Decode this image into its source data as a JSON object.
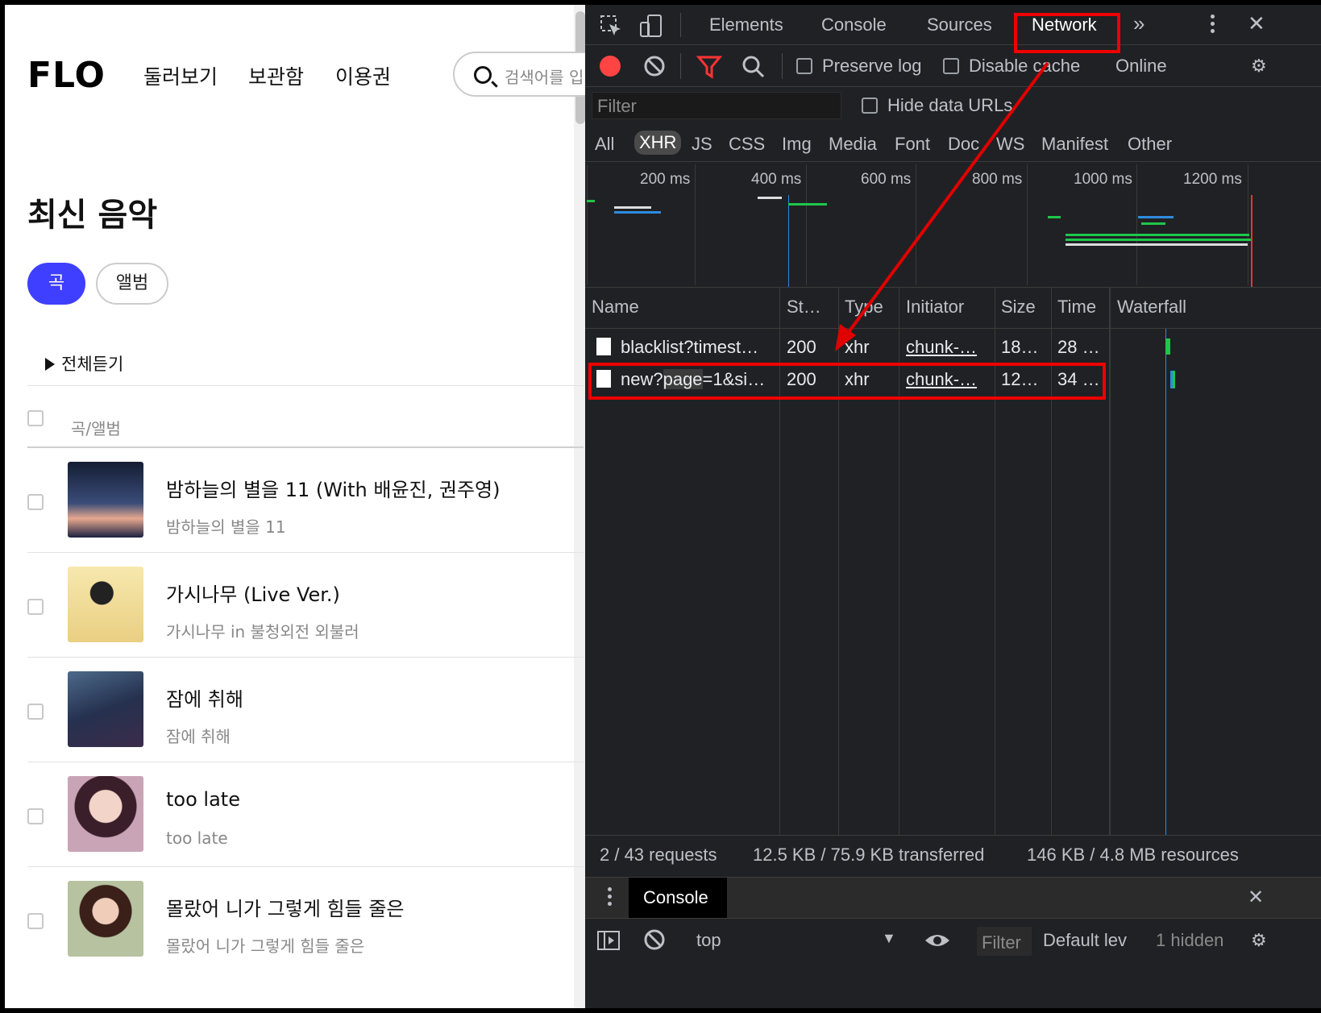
{
  "flo": {
    "logo": "FLO",
    "nav": [
      "둘러보기",
      "보관함",
      "이용권"
    ],
    "search_placeholder": "검색어를 입력",
    "title": "최신 음악",
    "pills": {
      "song": "곡",
      "album": "앨범"
    },
    "play_all": "전체듣기",
    "column_header": "곡/앨범",
    "tracks": [
      {
        "title": "밤하늘의 별을 11 (With 배윤진, 권주영)",
        "album": "밤하늘의 별을 11",
        "art": "#1c2845"
      },
      {
        "title": "가시나무 (Live Ver.)",
        "album": "가시나무 in 불청외전 외불러",
        "art": "#f3e2a3"
      },
      {
        "title": "잠에 취해",
        "album": "잠에 취해",
        "art": "#2b3a5a"
      },
      {
        "title": "too late",
        "album": "too late",
        "art": "#d9a9a6"
      },
      {
        "title": "몰랐어 니가 그렇게 힘들 줄은",
        "album": "몰랐어 니가 그렇게 힘들 줄은",
        "art": "#9c3b3b"
      }
    ]
  },
  "devtools": {
    "tabs": [
      "Elements",
      "Console",
      "Sources",
      "Network"
    ],
    "selected_tab": "Network",
    "more": "»",
    "toolbar": {
      "preserve_log": "Preserve log",
      "disable_cache": "Disable cache",
      "throttle": "Online"
    },
    "filter_placeholder": "Filter",
    "hide_data_urls": "Hide data URLs",
    "filter_types": [
      "All",
      "XHR",
      "JS",
      "CSS",
      "Img",
      "Media",
      "Font",
      "Doc",
      "WS",
      "Manifest",
      "Other"
    ],
    "selected_type": "XHR",
    "timeline_labels": [
      "200 ms",
      "400 ms",
      "600 ms",
      "800 ms",
      "1000 ms",
      "1200 ms"
    ],
    "columns": [
      "Name",
      "St…",
      "Type",
      "Initiator",
      "Size",
      "Time",
      "Waterfall"
    ],
    "requests": [
      {
        "name": "blacklist?timest…",
        "status": "200",
        "type": "xhr",
        "initiator": "chunk-…",
        "size": "18…",
        "time": "28 …"
      },
      {
        "name_pre": "new?",
        "name_hl": "page",
        "name_post": "=1&si…",
        "status": "200",
        "type": "xhr",
        "initiator": "chunk-…",
        "size": "12…",
        "time": "34 …"
      }
    ],
    "status_bar": {
      "requests": "2 / 43 requests",
      "transferred": "12.5 KB / 75.9 KB transferred",
      "resources": "146 KB / 4.8 MB resources"
    },
    "drawer": {
      "tab": "Console",
      "context": "top",
      "filter": "Filter",
      "levels": "Default lev",
      "hidden": "1 hidden"
    },
    "colors": {
      "highlight_red": "#e00000",
      "record_red": "#f44",
      "blue_line": "#2e8be0",
      "green_bar": "#1ec64b"
    }
  }
}
